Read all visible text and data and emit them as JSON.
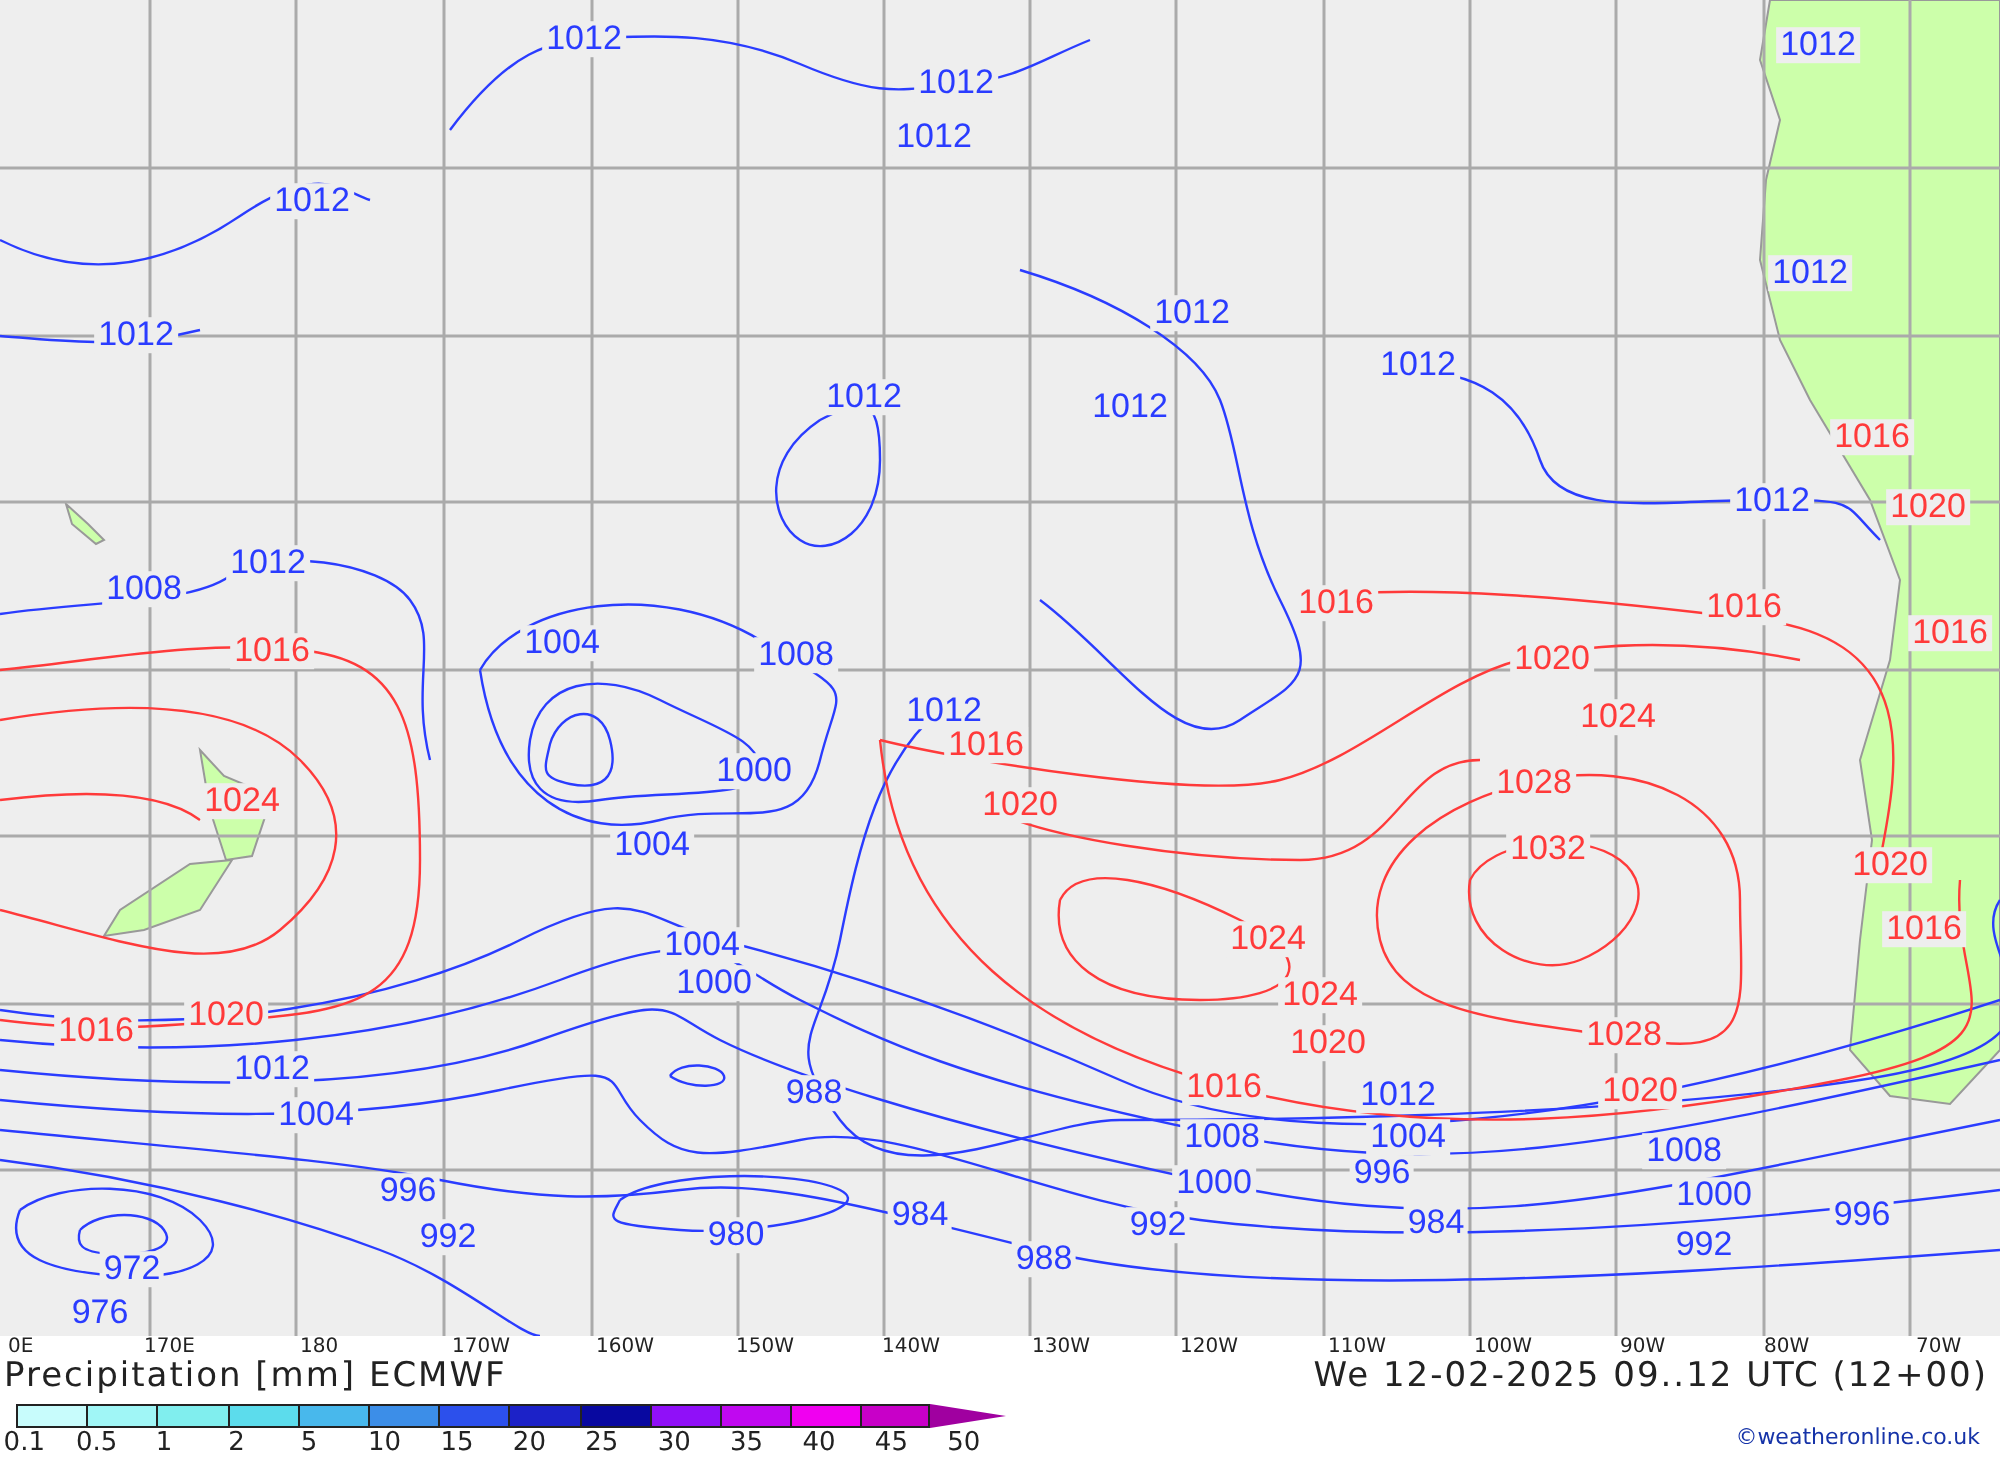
{
  "isobar_labels": [
    {
      "text": "1012",
      "color": "#2a3cff"
    },
    {
      "text": "1012",
      "color": "#2a3cff"
    },
    {
      "text": "1012",
      "color": "#2a3cff"
    },
    {
      "text": "1012",
      "color": "#2a3cff"
    },
    {
      "text": "1012",
      "color": "#2a3cff"
    },
    {
      "text": "1012",
      "color": "#2a3cff"
    },
    {
      "text": "1012",
      "color": "#2a3cff"
    },
    {
      "text": "1012",
      "color": "#2a3cff"
    },
    {
      "text": "1012",
      "color": "#2a3cff"
    },
    {
      "text": "1012",
      "color": "#2a3cff"
    },
    {
      "text": "1012",
      "color": "#2a3cff"
    },
    {
      "text": "1012",
      "color": "#2a3cff"
    },
    {
      "text": "1012",
      "color": "#2a3cff"
    },
    {
      "text": "1008",
      "color": "#2a3cff"
    },
    {
      "text": "1004",
      "color": "#2a3cff"
    },
    {
      "text": "1008",
      "color": "#2a3cff"
    },
    {
      "text": "1012",
      "color": "#2a3cff"
    },
    {
      "text": "1000",
      "color": "#2a3cff"
    },
    {
      "text": "1004",
      "color": "#2a3cff"
    },
    {
      "text": "1004",
      "color": "#2a3cff"
    },
    {
      "text": "1000",
      "color": "#2a3cff"
    },
    {
      "text": "1012",
      "color": "#2a3cff"
    },
    {
      "text": "1004",
      "color": "#2a3cff"
    },
    {
      "text": "988",
      "color": "#2a3cff"
    },
    {
      "text": "996",
      "color": "#2a3cff"
    },
    {
      "text": "992",
      "color": "#2a3cff"
    },
    {
      "text": "980",
      "color": "#2a3cff"
    },
    {
      "text": "984",
      "color": "#2a3cff"
    },
    {
      "text": "972",
      "color": "#2a3cff"
    },
    {
      "text": "976",
      "color": "#2a3cff"
    },
    {
      "text": "1012",
      "color": "#2a3cff"
    },
    {
      "text": "1008",
      "color": "#2a3cff"
    },
    {
      "text": "1004",
      "color": "#2a3cff"
    },
    {
      "text": "1000",
      "color": "#2a3cff"
    },
    {
      "text": "996",
      "color": "#2a3cff"
    },
    {
      "text": "992",
      "color": "#2a3cff"
    },
    {
      "text": "984",
      "color": "#2a3cff"
    },
    {
      "text": "988",
      "color": "#2a3cff"
    },
    {
      "text": "1008",
      "color": "#2a3cff"
    },
    {
      "text": "1000",
      "color": "#2a3cff"
    },
    {
      "text": "992",
      "color": "#2a3cff"
    },
    {
      "text": "996",
      "color": "#2a3cff"
    },
    {
      "text": "1016",
      "color": "#ff3a3a"
    },
    {
      "text": "1024",
      "color": "#ff3a3a"
    },
    {
      "text": "1020",
      "color": "#ff3a3a"
    },
    {
      "text": "1016",
      "color": "#ff3a3a"
    },
    {
      "text": "1016",
      "color": "#ff3a3a"
    },
    {
      "text": "1016",
      "color": "#ff3a3a"
    },
    {
      "text": "1016",
      "color": "#ff3a3a"
    },
    {
      "text": "1020",
      "color": "#ff3a3a"
    },
    {
      "text": "1020",
      "color": "#ff3a3a"
    },
    {
      "text": "1024",
      "color": "#ff3a3a"
    },
    {
      "text": "1028",
      "color": "#ff3a3a"
    },
    {
      "text": "1032",
      "color": "#ff3a3a"
    },
    {
      "text": "1024",
      "color": "#ff3a3a"
    },
    {
      "text": "1024",
      "color": "#ff3a3a"
    },
    {
      "text": "1020",
      "color": "#ff3a3a"
    },
    {
      "text": "1016",
      "color": "#ff3a3a"
    },
    {
      "text": "1028",
      "color": "#ff3a3a"
    },
    {
      "text": "1020",
      "color": "#ff3a3a"
    },
    {
      "text": "1016",
      "color": "#ff3a3a"
    },
    {
      "text": "1020",
      "color": "#ff3a3a"
    },
    {
      "text": "1016",
      "color": "#ff3a3a"
    },
    {
      "text": "1020",
      "color": "#ff3a3a"
    },
    {
      "text": "1016",
      "color": "#ff3a3a"
    }
  ],
  "longitude_labels": [
    "0E",
    "170E",
    "180",
    "170W",
    "160W",
    "150W",
    "140W",
    "130W",
    "120W",
    "110W",
    "100W",
    "90W",
    "80W",
    "70W"
  ],
  "title": "Precipitation [mm] ECMWF",
  "valid_time": "We 12-02-2025 09..12 UTC (12+00)",
  "legend": {
    "swatches": [
      {
        "color": "#c8fcfc"
      },
      {
        "color": "#a0f6f6"
      },
      {
        "color": "#80eeee"
      },
      {
        "color": "#5cdcec"
      },
      {
        "color": "#48b8ec"
      },
      {
        "color": "#3c8ee8"
      },
      {
        "color": "#2c50ec"
      },
      {
        "color": "#1c22c8"
      },
      {
        "color": "#0808a0"
      },
      {
        "color": "#9010f8"
      },
      {
        "color": "#c008f0"
      },
      {
        "color": "#f000f0"
      },
      {
        "color": "#c800c8"
      }
    ],
    "overflow": {
      "color": "#a000a0"
    },
    "values": [
      "0.1",
      "0.5",
      "1",
      "2",
      "5",
      "10",
      "15",
      "20",
      "25",
      "30",
      "35",
      "40",
      "45",
      "50"
    ]
  },
  "credit": "©weatheronline.co.uk"
}
